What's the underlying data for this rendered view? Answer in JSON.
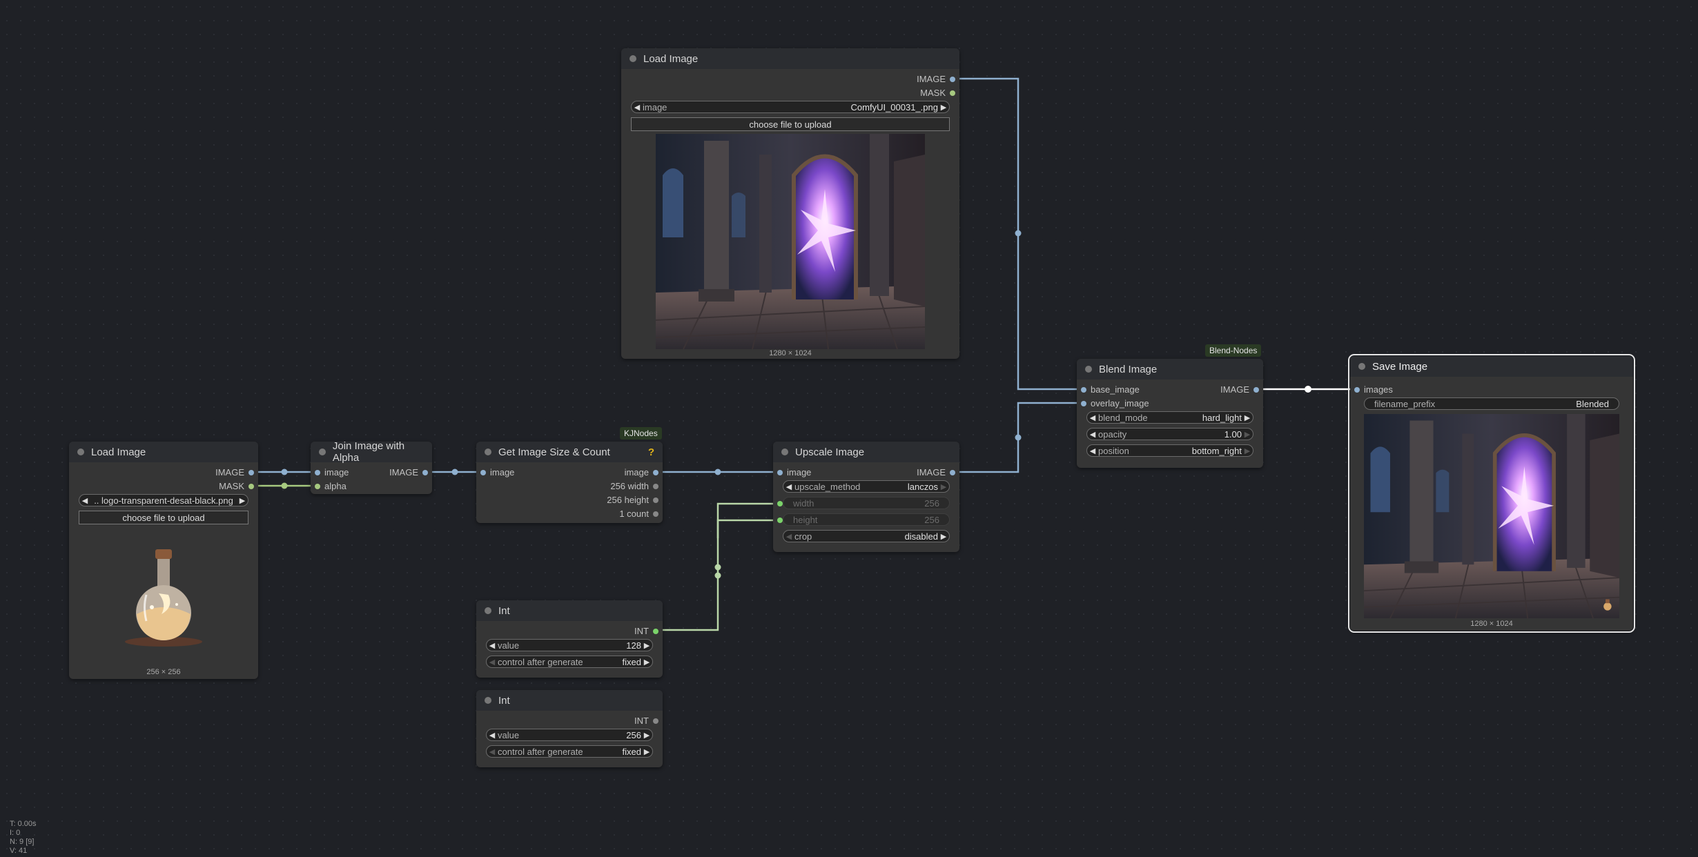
{
  "status": [
    "T: 0.00s",
    "I: 0",
    "N: 9 [9]",
    "V: 41"
  ],
  "badges": {
    "kjnodes": "KJNodes",
    "blend_nodes": "Blend-Nodes"
  },
  "nodes": {
    "load_image_top": {
      "title": "Load Image",
      "outputs": [
        "IMAGE",
        "MASK"
      ],
      "image_label": "image",
      "image_value": "ComfyUI_00031_.png",
      "upload_label": "choose file to upload",
      "dims": "1280 × 1024"
    },
    "load_image_left": {
      "title": "Load Image",
      "outputs": [
        "IMAGE",
        "MASK"
      ],
      "image_value": ".. logo-transparent-desat-black.png",
      "upload_label": "choose file to upload",
      "dims": "256 × 256"
    },
    "join_alpha": {
      "title": "Join Image with Alpha",
      "inputs": [
        "image",
        "alpha"
      ],
      "outputs": [
        "IMAGE"
      ]
    },
    "get_size": {
      "title": "Get Image Size & Count",
      "inputs": [
        "image"
      ],
      "outputs": [
        "image",
        "256 width",
        "256 height",
        "1 count"
      ],
      "warn": "?"
    },
    "upscale": {
      "title": "Upscale Image",
      "inputs": [
        "image"
      ],
      "outputs": [
        "IMAGE"
      ],
      "upscale_method_label": "upscale_method",
      "upscale_method_value": "lanczos",
      "width_label": "width",
      "width_value": "256",
      "height_label": "height",
      "height_value": "256",
      "crop_label": "crop",
      "crop_value": "disabled"
    },
    "int1": {
      "title": "Int",
      "outputs": [
        "INT"
      ],
      "value_label": "value",
      "value": "128",
      "control_label": "control after generate",
      "control_value": "fixed"
    },
    "int2": {
      "title": "Int",
      "outputs": [
        "INT"
      ],
      "value_label": "value",
      "value": "256",
      "control_label": "control after generate",
      "control_value": "fixed"
    },
    "blend": {
      "title": "Blend Image",
      "inputs": [
        "base_image",
        "overlay_image"
      ],
      "outputs": [
        "IMAGE"
      ],
      "blend_mode_label": "blend_mode",
      "blend_mode_value": "hard_light",
      "opacity_label": "opacity",
      "opacity_value": "1.00",
      "position_label": "position",
      "position_value": "bottom_right"
    },
    "save": {
      "title": "Save Image",
      "inputs": [
        "images"
      ],
      "prefix_label": "filename_prefix",
      "prefix_value": "Blended",
      "dims": "1280 × 1024"
    }
  },
  "colors": {
    "image_wire": "#8fb0cf",
    "mask_wire": "#a7c980",
    "int_wire": "#b9d7a8",
    "save_wire": "#ffffff",
    "node_bg": "#353535",
    "title_bg": "#2b2d31"
  }
}
